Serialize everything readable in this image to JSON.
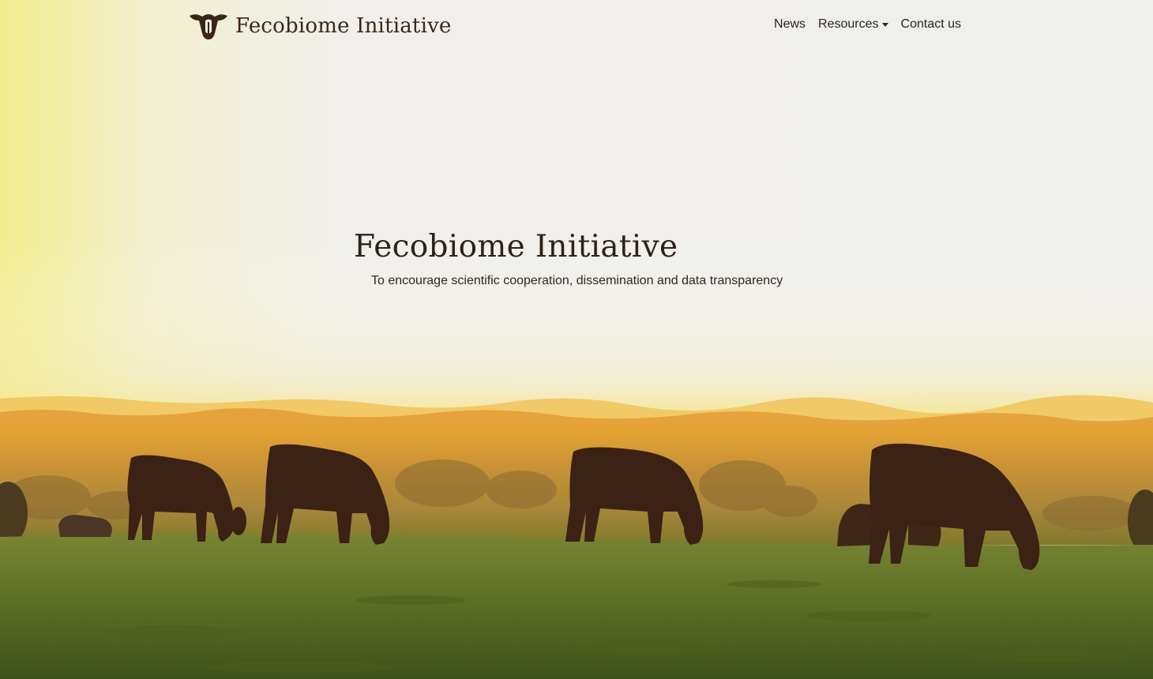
{
  "navbar": {
    "brand": {
      "name": "Fecobiome Initiative",
      "logo_icon": "cow-head-icon"
    },
    "links": [
      {
        "label": "News",
        "has_dropdown": false
      },
      {
        "label": "Resources",
        "has_dropdown": true
      },
      {
        "label": "Contact us",
        "has_dropdown": false
      }
    ]
  },
  "hero": {
    "title": "Fecobiome Initiative",
    "tagline": "To encourage scientific cooperation, dissemination and data transparency",
    "background_image": "cows-grazing-at-sunset"
  },
  "colors": {
    "text_dark": "#2e2219",
    "sky_light": "#f0efec",
    "sky_warm": "#f1ee9e",
    "horizon_gold": "#e9a836",
    "grass_green": "#5d7226",
    "cow_silhouette": "#3a2013"
  }
}
